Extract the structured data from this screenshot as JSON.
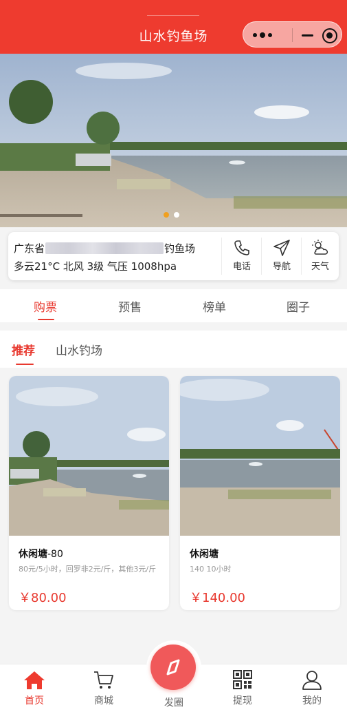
{
  "header": {
    "title": "山水钓鱼场"
  },
  "banner": {
    "slide_count": 2,
    "active_slide": 1
  },
  "info": {
    "name_prefix": "广东省",
    "name_suffix": "钓鱼场",
    "weather": "多云21°C  北风 3级 气压 1008hpa",
    "actions": [
      {
        "label": "电话",
        "icon": "phone-icon"
      },
      {
        "label": "导航",
        "icon": "navigation-icon"
      },
      {
        "label": "天气",
        "icon": "weather-icon"
      }
    ]
  },
  "tabs": [
    {
      "label": "购票",
      "active": true
    },
    {
      "label": "预售"
    },
    {
      "label": "榜单"
    },
    {
      "label": "圈子"
    }
  ],
  "subtabs": [
    {
      "label": "推荐",
      "active": true
    },
    {
      "label": "山水钓场"
    }
  ],
  "cards": [
    {
      "title": "休闲塘",
      "title_suffix": "-80",
      "desc": "80元/5小时，回罗非2元/斤，其他3元/斤",
      "price": "￥80.00"
    },
    {
      "title": "休闲塘",
      "title_suffix": "",
      "desc": "140 10小时",
      "price": "￥140.00"
    }
  ],
  "bottom_nav": [
    {
      "label": "首页",
      "icon": "home-icon",
      "active": true
    },
    {
      "label": "商城",
      "icon": "cart-icon"
    },
    {
      "label": "发圈",
      "icon": "compass-icon"
    },
    {
      "label": "提现",
      "icon": "qrcode-icon"
    },
    {
      "label": "我的",
      "icon": "user-icon"
    }
  ],
  "colors": {
    "primary": "#ee3b2f",
    "accent": "#e8392f",
    "fab": "#f0595a"
  }
}
